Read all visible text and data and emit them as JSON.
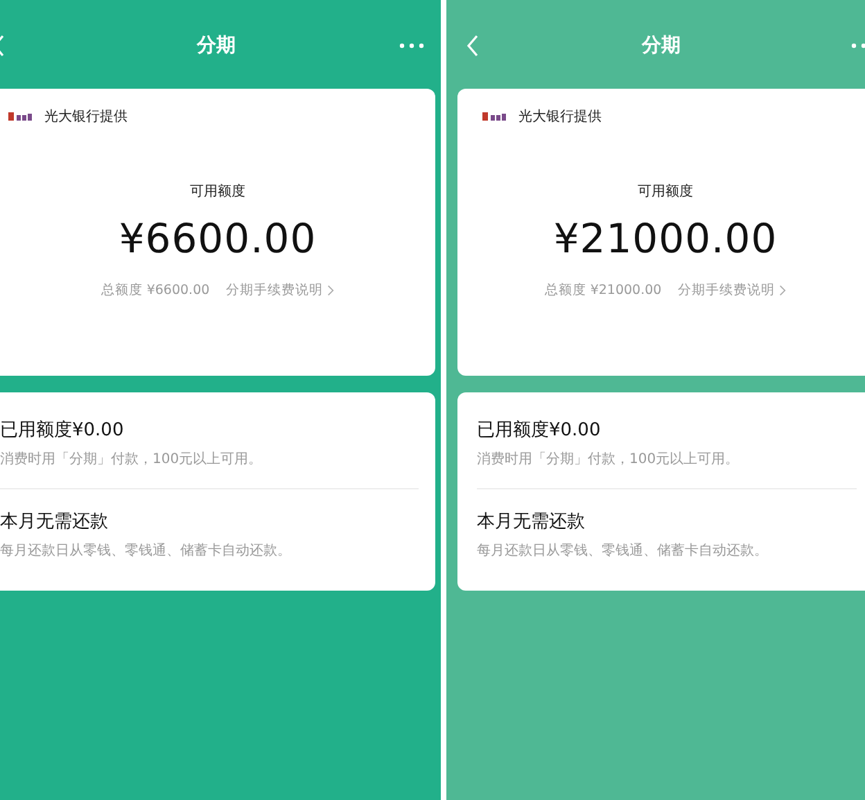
{
  "panels": [
    {
      "color": "#22b08a",
      "title": "分期",
      "provider": "光大银行提供",
      "available_label": "可用额度",
      "available_amount": "¥6600.00",
      "total_credit": "总额度 ¥6600.00",
      "fee_link": "分期手续费说明",
      "info_rows": [
        {
          "title": "已用额度¥0.00",
          "subtitle": "消费时用「分期」付款，100元以上可用。"
        },
        {
          "title": "本月无需还款",
          "subtitle": "每月还款日从零钱、零钱通、储蓄卡自动还款。"
        }
      ]
    },
    {
      "color": "#4fb894",
      "title": "分期",
      "provider": "光大银行提供",
      "available_label": "可用额度",
      "available_amount": "¥21000.00",
      "total_credit": "总额度 ¥21000.00",
      "fee_link": "分期手续费说明",
      "info_rows": [
        {
          "title": "已用额度¥0.00",
          "subtitle": "消费时用「分期」付款，100元以上可用。"
        },
        {
          "title": "本月无需还款",
          "subtitle": "每月还款日从零钱、零钱通、储蓄卡自动还款。"
        }
      ]
    }
  ]
}
